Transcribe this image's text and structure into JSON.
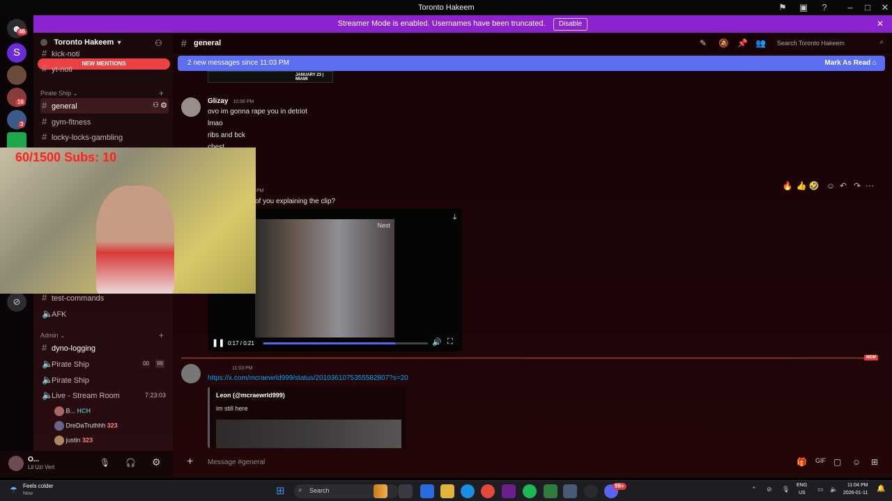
{
  "window": {
    "title": "Toronto Hakeem"
  },
  "banner": {
    "text": "Streamer Mode is enabled. Usernames have been truncated.",
    "disable_label": "Disable"
  },
  "guilds": {
    "badge_top": "46",
    "badge_a": "16",
    "badge_b": "3"
  },
  "server": {
    "name": "Toronto Hakeem"
  },
  "sidebar": {
    "channels_top": [
      {
        "label": "kick-noti"
      },
      {
        "label": "yt-noti"
      }
    ],
    "new_mentions": "NEW MENTIONS",
    "cat_pirate": "Pirate Ship",
    "pirate_channels": [
      {
        "label": "general"
      },
      {
        "label": "gym-fitness"
      },
      {
        "label": "locky-locks-gambling"
      }
    ],
    "lower_channels": [
      {
        "label": "test-commands"
      },
      {
        "label": "AFK"
      }
    ],
    "cat_admin": "Admin",
    "admin_channels": [
      {
        "label": "dyno-logging"
      },
      {
        "label": "Pirate Ship"
      },
      {
        "label": "Pirate Ship"
      },
      {
        "label": "Live - Stream Room"
      }
    ],
    "voice_badge_a": "00",
    "voice_badge_b": "99",
    "live_timer": "7:23:03",
    "voice_users": [
      {
        "name": "B...",
        "tag": "HCH"
      },
      {
        "name": "DreDaTruthhh",
        "tag": "323"
      },
      {
        "name": "justin",
        "tag": "323"
      }
    ]
  },
  "user_panel": {
    "name": "O...",
    "status": "Lil Uzi Vert"
  },
  "overlay": {
    "stream_stats": "60/1500  Subs: 10"
  },
  "topbar": {
    "channel": "general",
    "search_placeholder": "Search Toronto Hakeem"
  },
  "new_messages": {
    "text": "2 new messages since 11:03 PM",
    "mark_read": "Mark As Read"
  },
  "messages": {
    "embed_banner_text": "JANUARY 23 | MIAMI",
    "m1": {
      "author": "Glizay",
      "time": "10:58 PM",
      "lines": [
        "ovo im gonna rape you in detriot",
        "lmao",
        "ribs and bck",
        "chest"
      ]
    },
    "m2": {
      "time": "PM",
      "text": "of you explaining the clip?"
    },
    "video": {
      "time": "0:17 / 0:21",
      "watermark": "Nest",
      "progress": 0.8
    },
    "m3": {
      "time": "11:03 PM",
      "link": "https://x.com/mcraewrld999/status/2010361075355582807?s=20",
      "embed_author": "Leon (@mcraewrld999)",
      "embed_text": "im still here"
    },
    "new_divider": "NEW"
  },
  "composer": {
    "placeholder": "Message #general"
  },
  "taskbar": {
    "weather": "Feels colder",
    "weather_sub": "Now",
    "search": "Search",
    "lang": "ENG",
    "region": "US",
    "time": "11:04 PM",
    "date": "2026-01-11",
    "notif_badge": "99+"
  }
}
